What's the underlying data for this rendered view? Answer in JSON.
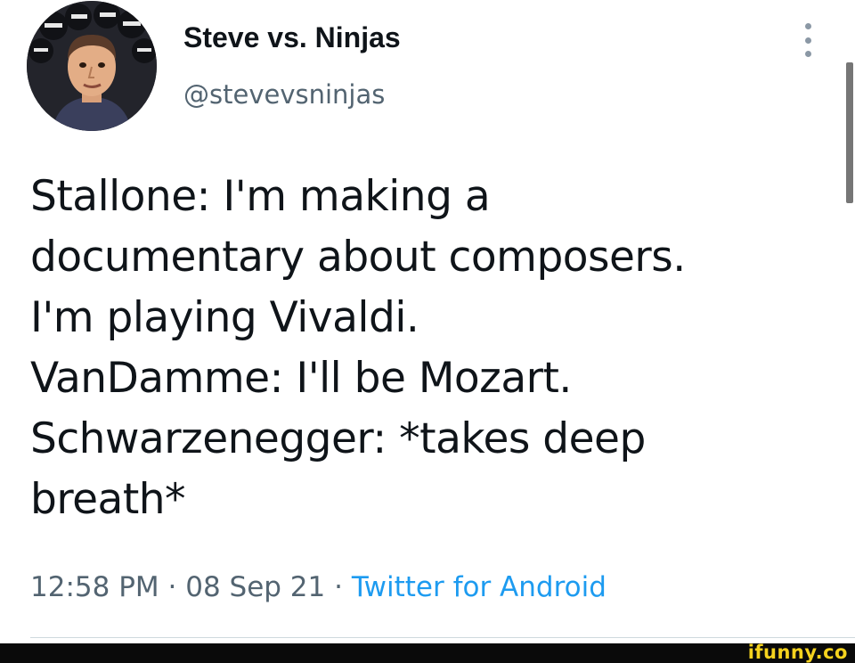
{
  "author": {
    "display_name": "Steve vs. Ninjas",
    "handle": "@stevevsninjas",
    "avatar_icon": "profile-photo"
  },
  "tweet": {
    "lines": [
      "Stallone: I'm making a",
      "documentary about composers.",
      "I'm playing Vivaldi.",
      "VanDamme: I'll be Mozart.",
      "Schwarzenegger: *takes deep",
      "breath*"
    ],
    "time": "12:58 PM",
    "separator": "·",
    "date": "08 Sep 21",
    "source": "Twitter for Android"
  },
  "menu": {
    "icon": "more-vertical-icon"
  },
  "watermark": {
    "text": "ifunny.co"
  },
  "colors": {
    "text": "#0f1419",
    "secondary": "#536471",
    "link": "#1d9bf0",
    "watermark": "#f5d21e"
  }
}
